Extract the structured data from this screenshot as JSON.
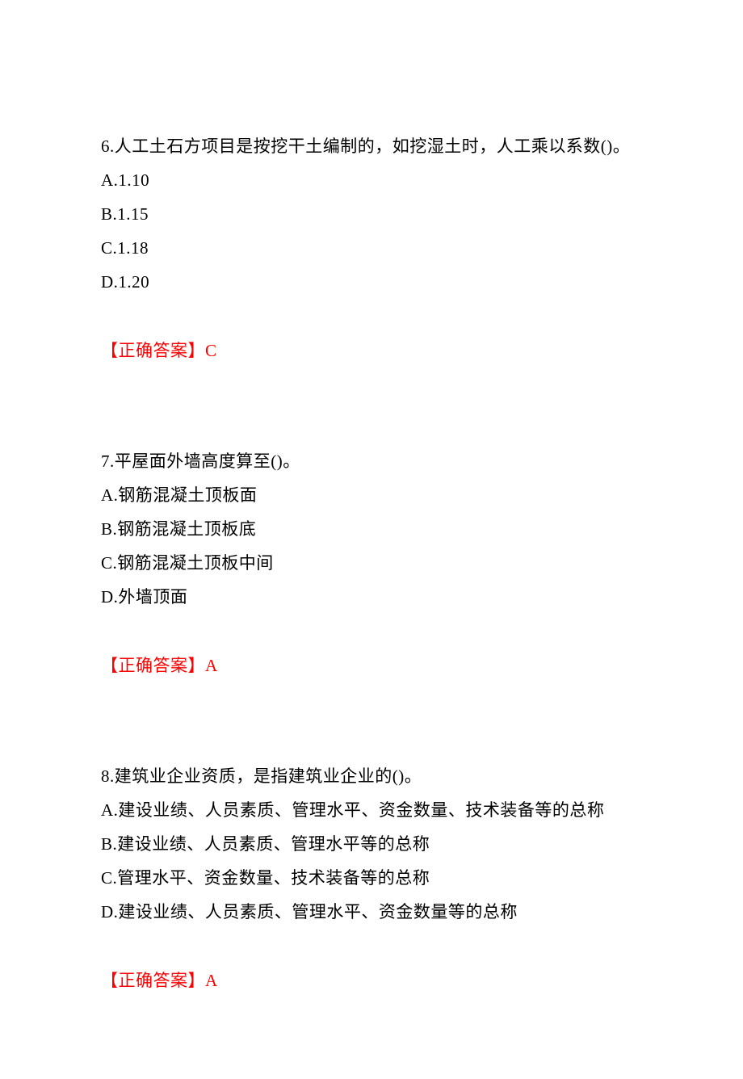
{
  "questions": [
    {
      "number": "6",
      "stem": "6.人工土石方项目是按挖干土编制的，如挖湿土时，人工乘以系数()。",
      "options": {
        "A": "A.1.10",
        "B": "B.1.15",
        "C": "C.1.18",
        "D": "D.1.20"
      },
      "answer_label": "【正确答案】",
      "answer_value": "C"
    },
    {
      "number": "7",
      "stem": "7.平屋面外墙高度算至()。",
      "options": {
        "A": "A.钢筋混凝土顶板面",
        "B": "B.钢筋混凝土顶板底",
        "C": "C.钢筋混凝土顶板中间",
        "D": "D.外墙顶面"
      },
      "answer_label": "【正确答案】",
      "answer_value": "A"
    },
    {
      "number": "8",
      "stem": "8.建筑业企业资质，是指建筑业企业的()。",
      "options": {
        "A": "A.建设业绩、人员素质、管理水平、资金数量、技术装备等的总称",
        "B": "B.建设业绩、人员素质、管理水平等的总称",
        "C": "C.管理水平、资金数量、技术装备等的总称",
        "D": "D.建设业绩、人员素质、管理水平、资金数量等的总称"
      },
      "answer_label": "【正确答案】",
      "answer_value": "A"
    }
  ]
}
